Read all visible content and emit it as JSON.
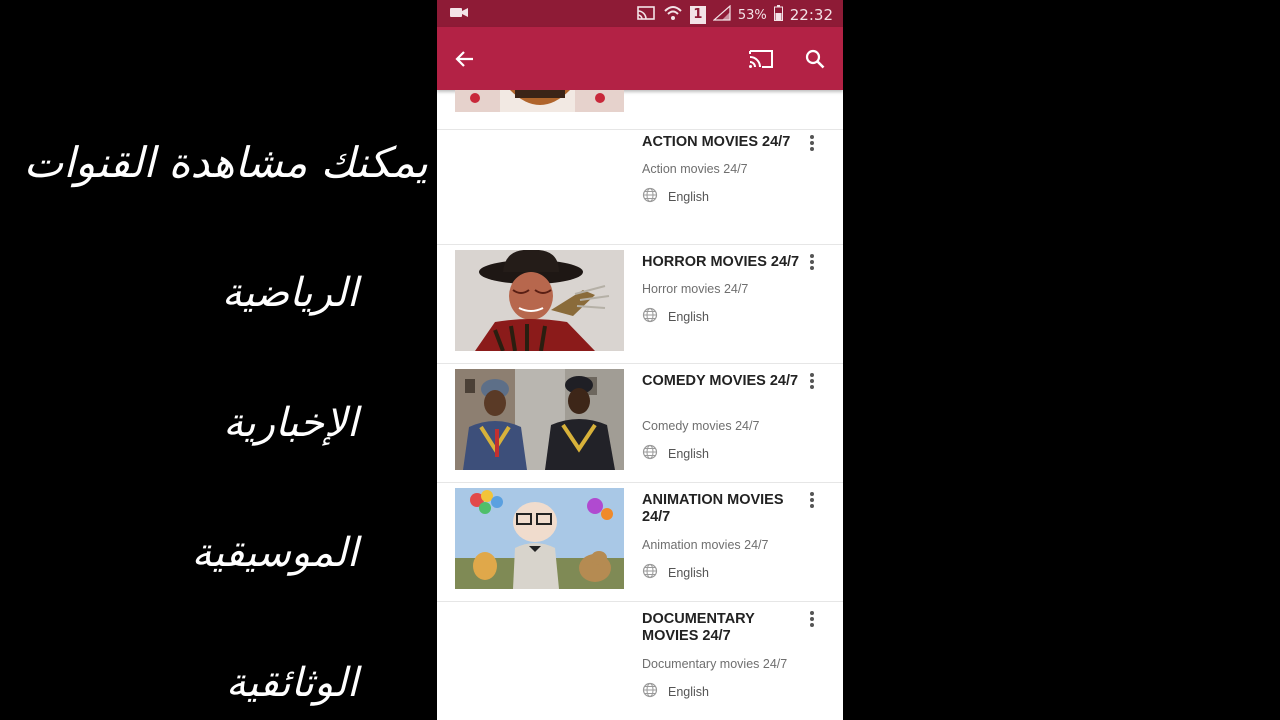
{
  "overlay_captions": [
    "يمكنك مشاهدة القنوات",
    "الرياضية",
    "الإخبارية",
    "الموسيقية",
    "الوثائقية"
  ],
  "status_bar": {
    "battery": "53%",
    "time": "22:32",
    "sim_badge": "1"
  },
  "app_bar": {
    "icons": [
      "back-arrow-icon",
      "cast-icon",
      "search-icon"
    ]
  },
  "channels": [
    {
      "title": "ACTION MOVIES 24/7",
      "subtitle": "Action movies 24/7",
      "language": "English",
      "thumb": "blank"
    },
    {
      "title": "HORROR MOVIES 24/7",
      "subtitle": "Horror movies 24/7",
      "language": "English",
      "thumb": "horror"
    },
    {
      "title": "COMEDY MOVIES 24/7",
      "subtitle": "Comedy movies 24/7",
      "language": "English",
      "thumb": "comedy"
    },
    {
      "title": "ANIMATION MOVIES 24/7",
      "subtitle": "Animation movies 24/7",
      "language": "English",
      "thumb": "animation"
    },
    {
      "title": "DOCUMENTARY MOVIES 24/7",
      "subtitle": "Documentary movies 24/7",
      "language": "English",
      "thumb": "blank"
    }
  ],
  "colors": {
    "status_bar": "#8e1b36",
    "app_bar": "#b32245",
    "background": "#000000"
  }
}
